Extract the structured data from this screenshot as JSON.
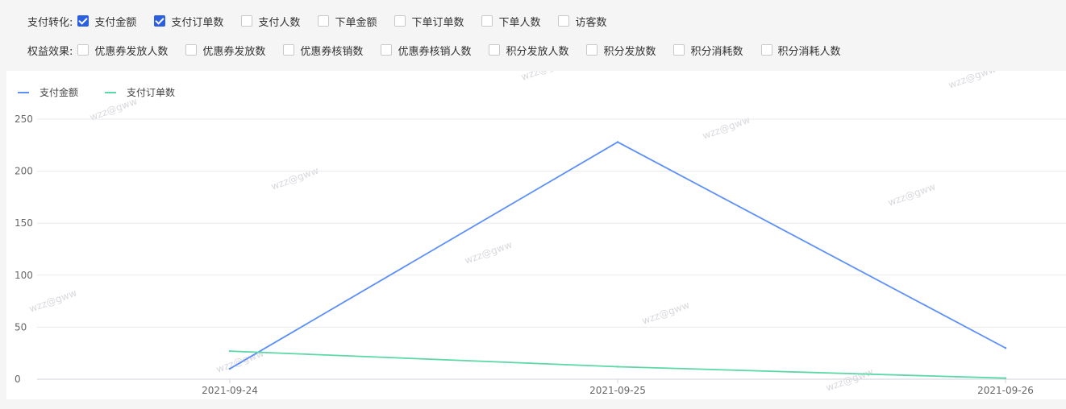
{
  "filters": {
    "row1": {
      "label": "支付转化:",
      "options": [
        {
          "label": "支付金额",
          "checked": true
        },
        {
          "label": "支付订单数",
          "checked": true
        },
        {
          "label": "支付人数",
          "checked": false
        },
        {
          "label": "下单金额",
          "checked": false
        },
        {
          "label": "下单订单数",
          "checked": false
        },
        {
          "label": "下单人数",
          "checked": false
        },
        {
          "label": "访客数",
          "checked": false
        }
      ]
    },
    "row2": {
      "label": "权益效果:",
      "options": [
        {
          "label": "优惠券发放人数",
          "checked": false
        },
        {
          "label": "优惠券发放数",
          "checked": false
        },
        {
          "label": "优惠券核销数",
          "checked": false
        },
        {
          "label": "优惠券核销人数",
          "checked": false
        },
        {
          "label": "积分发放人数",
          "checked": false
        },
        {
          "label": "积分发放数",
          "checked": false
        },
        {
          "label": "积分消耗数",
          "checked": false
        },
        {
          "label": "积分消耗人数",
          "checked": false
        }
      ]
    }
  },
  "watermark": "wzz@gww",
  "chart_data": {
    "type": "line",
    "title": "",
    "xlabel": "",
    "ylabel": "",
    "x": [
      "2021-09-24",
      "2021-09-25",
      "2021-09-26"
    ],
    "ylim": [
      0,
      250
    ],
    "yticks": [
      0,
      50,
      100,
      150,
      200,
      250
    ],
    "grid": true,
    "legend_position": "top-left",
    "series": [
      {
        "name": "支付金额",
        "color": "#5b8ff9",
        "values": [
          10,
          228,
          30
        ]
      },
      {
        "name": "支付订单数",
        "color": "#5ad8a6",
        "values": [
          27,
          12,
          1
        ]
      }
    ]
  }
}
